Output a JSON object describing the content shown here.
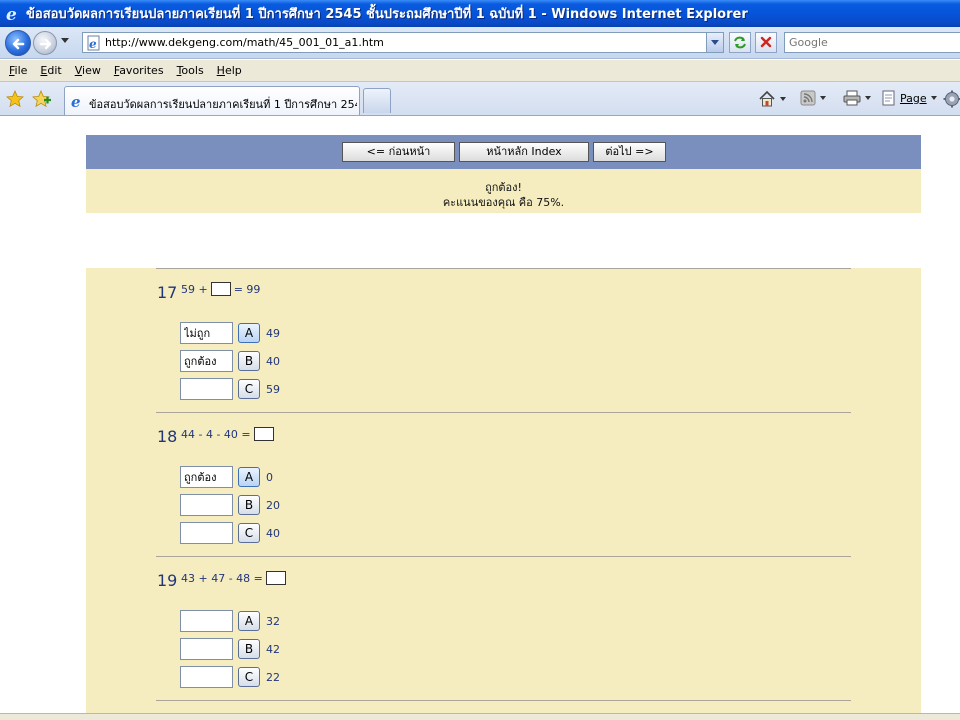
{
  "window": {
    "title": "ข้อสอบวัดผลการเรียนปลายภาคเรียนที่ 1 ปีการศึกษา 2545 ชั้นประถมศึกษาปีที่ 1 ฉบับที่ 1 - Windows Internet Explorer"
  },
  "address": {
    "url": "http://www.dekgeng.com/math/45_001_01_a1.htm",
    "search_placeholder": "Google"
  },
  "menu": {
    "file": "File",
    "edit": "Edit",
    "view": "View",
    "favorites": "Favorites",
    "tools": "Tools",
    "help": "Help",
    "file_rest": "ile",
    "edit_rest": "dit",
    "view_rest": "iew",
    "favorites_rest": "avorites",
    "tools_rest": "ools",
    "help_rest": "elp",
    "file_key": "F",
    "edit_key": "E",
    "view_key": "V",
    "favorites_key": "F",
    "tools_key": "T",
    "help_key": "H"
  },
  "tabs": {
    "active_label": "ข้อสอบวัดผลการเรียนปลายภาคเรียนที่ 1 ปีการศึกษา 254..."
  },
  "commandbar": {
    "page_label": "Page"
  },
  "nav": {
    "prev_label": "<=   ก่อนหน้า",
    "home_label": "หน้าหลัก   Index",
    "next_label": "ต่อไป =>"
  },
  "result": {
    "message": "ถูกต้อง!",
    "score": "คะแนนของคุณ คือ 75%."
  },
  "questions": [
    {
      "number": "17",
      "expr_before": "59 +",
      "expr_after": "= 99",
      "options": [
        {
          "letter": "A",
          "value": "49",
          "feedback": "ไม่ถูก"
        },
        {
          "letter": "B",
          "value": "40",
          "feedback": "ถูกต้อง"
        },
        {
          "letter": "C",
          "value": "59",
          "feedback": ""
        }
      ]
    },
    {
      "number": "18",
      "expr_before": "44 - 4 - 40 =",
      "expr_after": "",
      "options": [
        {
          "letter": "A",
          "value": "0",
          "feedback": "ถูกต้อง"
        },
        {
          "letter": "B",
          "value": "20",
          "feedback": ""
        },
        {
          "letter": "C",
          "value": "40",
          "feedback": ""
        }
      ]
    },
    {
      "number": "19",
      "expr_before": "43 + 47 - 48 =",
      "expr_after": "",
      "options": [
        {
          "letter": "A",
          "value": "32",
          "feedback": ""
        },
        {
          "letter": "B",
          "value": "42",
          "feedback": ""
        },
        {
          "letter": "C",
          "value": "22",
          "feedback": ""
        }
      ]
    }
  ]
}
